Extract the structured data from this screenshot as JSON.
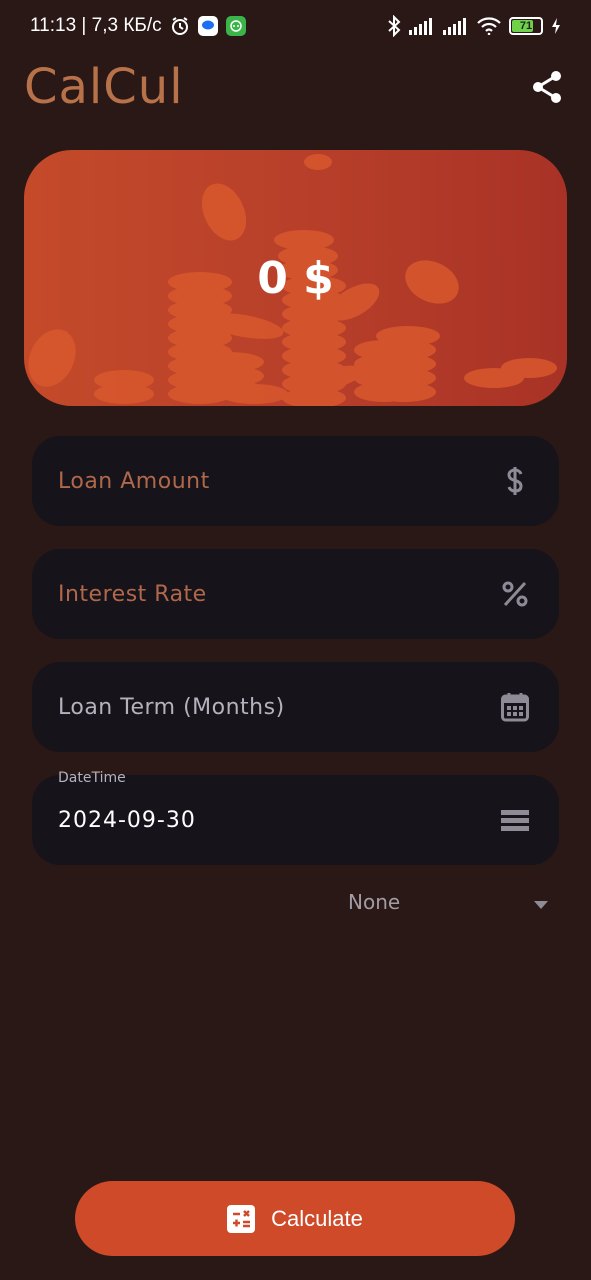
{
  "status_bar": {
    "time_speed": "11:13 | 7,3 КБ/с",
    "battery_level": "71",
    "icons": [
      "alarm-icon",
      "messages-icon",
      "android-app-icon",
      "bluetooth-icon",
      "signal-icon",
      "signal-icon",
      "wifi-icon",
      "battery-icon",
      "charging-icon"
    ]
  },
  "header": {
    "title": "CalCul",
    "share_icon": "share-icon"
  },
  "hero": {
    "amount": "0 $"
  },
  "fields": {
    "loan_amount": {
      "placeholder": "Loan Amount",
      "icon": "dollar-icon"
    },
    "interest_rate": {
      "placeholder": "Interest Rate",
      "icon": "percent-icon"
    },
    "loan_term": {
      "placeholder": "Loan Term (Months)",
      "icon": "calendar-icon"
    },
    "datetime": {
      "label": "DateTime",
      "value": "2024-09-30",
      "icon": "menu-icon"
    }
  },
  "dropdown": {
    "selected": "None"
  },
  "calculate_button": {
    "label": "Calculate",
    "icon": "calculator-icon"
  },
  "colors": {
    "background": "#2a1816",
    "accent": "#b0684a",
    "button": "#cf4a28",
    "field": "#16131a"
  }
}
